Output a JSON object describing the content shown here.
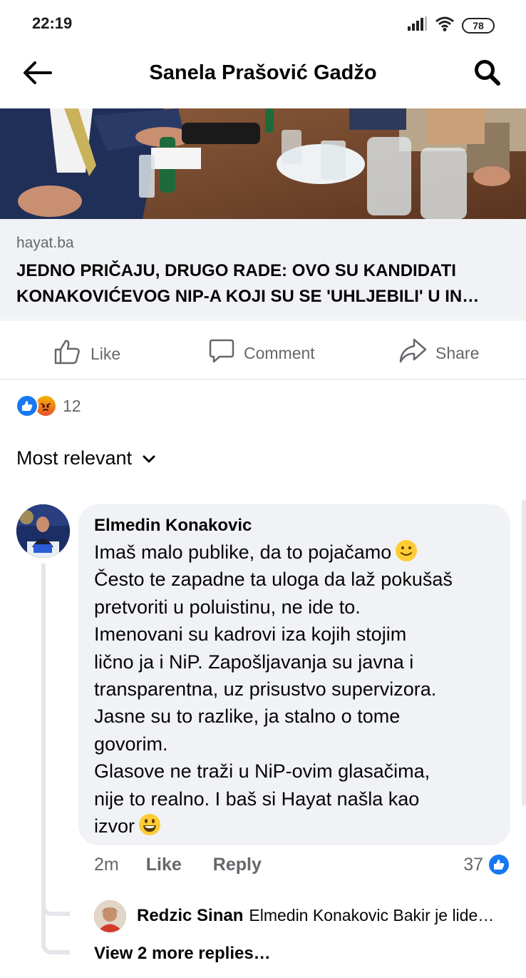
{
  "status_bar": {
    "time": "22:19",
    "battery": "78",
    "icons": [
      "signal-icon",
      "wifi-icon",
      "battery-icon"
    ]
  },
  "header": {
    "title": "Sanela Prašović Gadžo",
    "back_icon": "arrow-left-icon",
    "search_icon": "search-icon"
  },
  "link_preview": {
    "domain": "hayat.ba",
    "title_line1": "JEDNO PRIČAJU, DRUGO RADE: OVO SU KANDIDATI",
    "title_line2": "KONAKOVIĆEVOG NIP-A KOJI SU SE 'UHLJEBILI' U IN…"
  },
  "actions": {
    "like_label": "Like",
    "comment_label": "Comment",
    "share_label": "Share"
  },
  "reactions": {
    "types": [
      "like",
      "angry"
    ],
    "count": "12"
  },
  "sort": {
    "label": "Most relevant"
  },
  "comment": {
    "author": "Elmedin Konakovic",
    "lines": [
      "Imaš malo publike, da to pojačamo",
      "Često te zapadne ta uloga da laž pokušaš",
      "pretvoriti u poluistinu, ne ide to.",
      "Imenovani su kadrovi iza kojih stojim",
      "lično ja i NiP. Zapošljavanja su javna i",
      "transparentna, uz prisustvo supervizora.",
      "Jasne su to razlike, ja stalno o tome",
      "govorim.",
      "Glasove ne traži u NiP-ovim glasačima,",
      "nije to realno. I baš si Hayat našla kao",
      "izvor"
    ],
    "time": "2m",
    "like_label": "Like",
    "reply_label": "Reply",
    "reaction_count": "37"
  },
  "reply": {
    "author": "Redzic Sinan",
    "text": "Elmedin Konakovic Bakir je lide…"
  },
  "more_replies": "View 2 more replies…",
  "colors": {
    "accent": "#1877f2",
    "secondary_text": "#65676b",
    "bubble_bg": "#f0f2f5"
  }
}
